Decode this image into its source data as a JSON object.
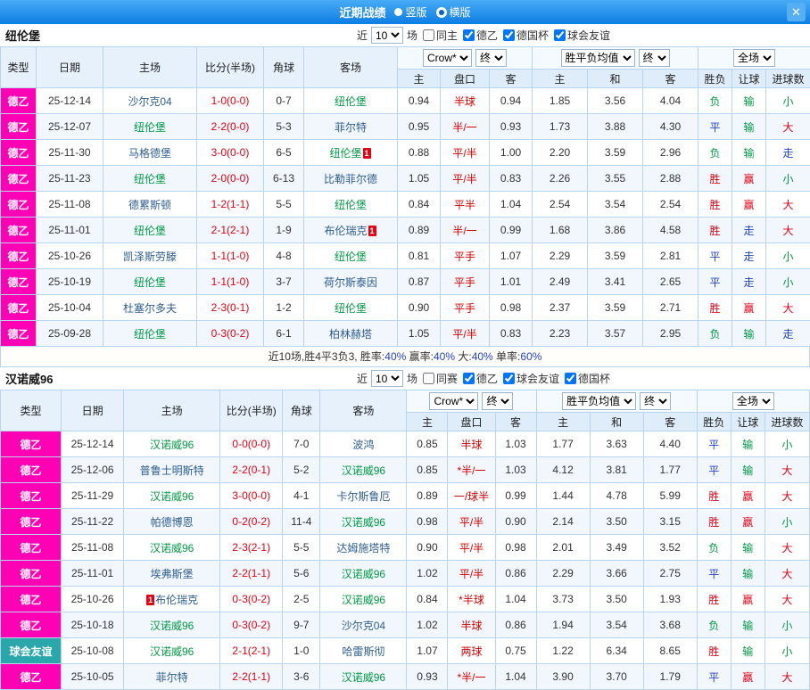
{
  "titlebar": {
    "title": "近期战绩",
    "radio_vertical": "竖版",
    "radio_horizontal": "横版",
    "close_icon": "✕"
  },
  "filter_labels": {
    "near": "近",
    "games": "场"
  },
  "columns": {
    "left": [
      "类型",
      "日期",
      "主场",
      "比分(半场)",
      "角球",
      "客场"
    ],
    "group_selects": [
      [
        "Crow*",
        "终"
      ],
      [
        "胜平负均值",
        "终"
      ],
      [
        "全场"
      ]
    ],
    "sub": [
      "主",
      "盘口",
      "客",
      "主",
      "和",
      "客",
      "胜负",
      "让球",
      "进球数"
    ]
  },
  "colors": {
    "league": {
      "德乙": "#ff00b4",
      "球会友谊": "#2aa7ab"
    },
    "result": {
      "胜": "#e60012",
      "赢": "#e60012",
      "大": "#e60012",
      "平": "#2144cc",
      "走": "#2144cc",
      "负": "#009944",
      "输": "#009944",
      "小": "#009944"
    },
    "score": "#e60012",
    "handicap": "#d40000",
    "self_team": "#009944",
    "opp_team": "#2f5e8f",
    "date": "#333333",
    "odds": "#333333"
  },
  "sections": [
    {
      "team": "纽伦堡",
      "count": "10",
      "filters": [
        {
          "label": "同主",
          "checked": false
        },
        {
          "label": "德乙",
          "checked": true
        },
        {
          "label": "德国杯",
          "checked": true
        },
        {
          "label": "球会友谊",
          "checked": true
        }
      ],
      "rows": [
        {
          "league": "德乙",
          "date": "25-12-14",
          "home": {
            "name": "沙尔克04",
            "self": false
          },
          "score": "1-0(0-0)",
          "corners": "0-7",
          "away": {
            "name": "纽伦堡",
            "self": true
          },
          "odds": [
            "0.94",
            "半球",
            "0.94"
          ],
          "avg": [
            "1.85",
            "3.56",
            "4.04"
          ],
          "results": [
            "负",
            "输",
            "小"
          ]
        },
        {
          "league": "德乙",
          "date": "25-12-07",
          "home": {
            "name": "纽伦堡",
            "self": true
          },
          "score": "2-2(0-0)",
          "corners": "5-3",
          "away": {
            "name": "菲尔特",
            "self": false
          },
          "odds": [
            "0.95",
            "半/一",
            "0.93"
          ],
          "avg": [
            "1.73",
            "3.88",
            "4.30"
          ],
          "results": [
            "平",
            "输",
            "大"
          ]
        },
        {
          "league": "德乙",
          "date": "25-11-30",
          "home": {
            "name": "马格德堡",
            "self": false
          },
          "score": "3-0(0-0)",
          "corners": "6-5",
          "away": {
            "name": "纽伦堡",
            "self": true,
            "badge": "1"
          },
          "odds": [
            "0.88",
            "平/半",
            "1.00"
          ],
          "avg": [
            "2.20",
            "3.59",
            "2.96"
          ],
          "results": [
            "负",
            "输",
            "走"
          ]
        },
        {
          "league": "德乙",
          "date": "25-11-23",
          "home": {
            "name": "纽伦堡",
            "self": true
          },
          "score": "2-0(0-0)",
          "corners": "6-13",
          "away": {
            "name": "比勒菲尔德",
            "self": false
          },
          "odds": [
            "1.05",
            "平/半",
            "0.83"
          ],
          "avg": [
            "2.26",
            "3.55",
            "2.88"
          ],
          "results": [
            "胜",
            "赢",
            "小"
          ]
        },
        {
          "league": "德乙",
          "date": "25-11-08",
          "home": {
            "name": "德累斯顿",
            "self": false
          },
          "score": "1-2(1-1)",
          "corners": "5-5",
          "away": {
            "name": "纽伦堡",
            "self": true
          },
          "odds": [
            "0.84",
            "平半",
            "1.04"
          ],
          "avg": [
            "2.54",
            "3.54",
            "2.54"
          ],
          "results": [
            "胜",
            "赢",
            "大"
          ]
        },
        {
          "league": "德乙",
          "date": "25-11-01",
          "home": {
            "name": "纽伦堡",
            "self": true
          },
          "score": "2-1(2-1)",
          "corners": "1-9",
          "away": {
            "name": "布伦瑞克",
            "self": false,
            "badge": "1"
          },
          "odds": [
            "0.89",
            "半/一",
            "0.99"
          ],
          "avg": [
            "1.68",
            "3.86",
            "4.58"
          ],
          "results": [
            "胜",
            "走",
            "大"
          ]
        },
        {
          "league": "德乙",
          "date": "25-10-26",
          "home": {
            "name": "凯泽斯劳滕",
            "self": false
          },
          "score": "1-1(1-0)",
          "corners": "4-8",
          "away": {
            "name": "纽伦堡",
            "self": true
          },
          "odds": [
            "0.81",
            "平手",
            "1.07"
          ],
          "avg": [
            "2.29",
            "3.59",
            "2.81"
          ],
          "results": [
            "平",
            "走",
            "小"
          ]
        },
        {
          "league": "德乙",
          "date": "25-10-19",
          "home": {
            "name": "纽伦堡",
            "self": true
          },
          "score": "1-1(1-0)",
          "corners": "3-7",
          "away": {
            "name": "荷尔斯泰因",
            "self": false
          },
          "odds": [
            "0.87",
            "平手",
            "1.01"
          ],
          "avg": [
            "2.49",
            "3.41",
            "2.65"
          ],
          "results": [
            "平",
            "走",
            "小"
          ]
        },
        {
          "league": "德乙",
          "date": "25-10-04",
          "home": {
            "name": "杜塞尔多夫",
            "self": false
          },
          "score": "2-3(0-1)",
          "corners": "1-2",
          "away": {
            "name": "纽伦堡",
            "self": true
          },
          "odds": [
            "0.90",
            "平手",
            "0.98"
          ],
          "avg": [
            "2.37",
            "3.59",
            "2.71"
          ],
          "results": [
            "胜",
            "赢",
            "大"
          ]
        },
        {
          "league": "德乙",
          "date": "25-09-28",
          "home": {
            "name": "纽伦堡",
            "self": true
          },
          "score": "0-3(0-2)",
          "corners": "6-1",
          "away": {
            "name": "柏林赫塔",
            "self": false
          },
          "odds": [
            "1.05",
            "平/半",
            "0.83"
          ],
          "avg": [
            "2.23",
            "3.57",
            "2.95"
          ],
          "results": [
            "负",
            "输",
            "走"
          ]
        }
      ],
      "summary": [
        {
          "t": "近10场,胜4平3负3, 胜率:",
          "c": "#333333"
        },
        {
          "t": "40%",
          "c": "#2144cc"
        },
        {
          "t": " 赢率:",
          "c": "#333333"
        },
        {
          "t": "40%",
          "c": "#2144cc"
        },
        {
          "t": " 大:",
          "c": "#333333"
        },
        {
          "t": "40%",
          "c": "#2144cc"
        },
        {
          "t": " 单率:",
          "c": "#333333"
        },
        {
          "t": "60%",
          "c": "#2144cc"
        }
      ]
    },
    {
      "team": "汉诺威96",
      "count": "10",
      "filters": [
        {
          "label": "同赛",
          "checked": false
        },
        {
          "label": "德乙",
          "checked": true
        },
        {
          "label": "球会友谊",
          "checked": true
        },
        {
          "label": "德国杯",
          "checked": true
        }
      ],
      "rows": [
        {
          "league": "德乙",
          "date": "25-12-14",
          "home": {
            "name": "汉诺威96",
            "self": true
          },
          "score": "0-0(0-0)",
          "corners": "7-0",
          "away": {
            "name": "波鸿",
            "self": false
          },
          "odds": [
            "0.85",
            "半球",
            "1.03"
          ],
          "avg": [
            "1.77",
            "3.63",
            "4.40"
          ],
          "results": [
            "平",
            "输",
            "小"
          ]
        },
        {
          "league": "德乙",
          "date": "25-12-06",
          "home": {
            "name": "普鲁士明斯特",
            "self": false
          },
          "score": "2-2(0-1)",
          "corners": "5-2",
          "away": {
            "name": "汉诺威96",
            "self": true
          },
          "odds": [
            "0.85",
            "*半/一",
            "1.03"
          ],
          "avg": [
            "4.12",
            "3.81",
            "1.77"
          ],
          "results": [
            "平",
            "输",
            "大"
          ]
        },
        {
          "league": "德乙",
          "date": "25-11-29",
          "home": {
            "name": "汉诺威96",
            "self": true
          },
          "score": "3-0(0-0)",
          "corners": "4-1",
          "away": {
            "name": "卡尔斯鲁厄",
            "self": false
          },
          "odds": [
            "0.89",
            "一/球半",
            "0.99"
          ],
          "avg": [
            "1.44",
            "4.78",
            "5.99"
          ],
          "results": [
            "胜",
            "赢",
            "大"
          ]
        },
        {
          "league": "德乙",
          "date": "25-11-22",
          "home": {
            "name": "帕德博恩",
            "self": false
          },
          "score": "0-2(0-2)",
          "corners": "11-4",
          "away": {
            "name": "汉诺威96",
            "self": true
          },
          "odds": [
            "0.98",
            "平/半",
            "0.90"
          ],
          "avg": [
            "2.14",
            "3.50",
            "3.15"
          ],
          "results": [
            "胜",
            "赢",
            "小"
          ]
        },
        {
          "league": "德乙",
          "date": "25-11-08",
          "home": {
            "name": "汉诺威96",
            "self": true
          },
          "score": "2-3(2-1)",
          "corners": "5-5",
          "away": {
            "name": "达姆施塔特",
            "self": false
          },
          "odds": [
            "0.90",
            "平/半",
            "0.98"
          ],
          "avg": [
            "2.01",
            "3.49",
            "3.52"
          ],
          "results": [
            "负",
            "输",
            "大"
          ]
        },
        {
          "league": "德乙",
          "date": "25-11-01",
          "home": {
            "name": "埃弗斯堡",
            "self": false
          },
          "score": "2-2(1-1)",
          "corners": "5-6",
          "away": {
            "name": "汉诺威96",
            "self": true
          },
          "odds": [
            "1.02",
            "平/半",
            "0.86"
          ],
          "avg": [
            "2.29",
            "3.66",
            "2.75"
          ],
          "results": [
            "平",
            "输",
            "大"
          ]
        },
        {
          "league": "德乙",
          "date": "25-10-26",
          "home": {
            "name": "布伦瑞克",
            "self": false,
            "badge": "1",
            "badge_pos": "before"
          },
          "score": "0-3(0-2)",
          "corners": "2-5",
          "away": {
            "name": "汉诺威96",
            "self": true
          },
          "odds": [
            "0.84",
            "*半球",
            "1.04"
          ],
          "avg": [
            "3.73",
            "3.50",
            "1.93"
          ],
          "results": [
            "胜",
            "赢",
            "大"
          ]
        },
        {
          "league": "德乙",
          "date": "25-10-18",
          "home": {
            "name": "汉诺威96",
            "self": true
          },
          "score": "0-3(0-2)",
          "corners": "9-7",
          "away": {
            "name": "沙尔克04",
            "self": false
          },
          "odds": [
            "1.02",
            "半球",
            "0.86"
          ],
          "avg": [
            "1.94",
            "3.54",
            "3.68"
          ],
          "results": [
            "负",
            "输",
            "小"
          ]
        },
        {
          "league": "球会友谊",
          "date": "25-10-08",
          "home": {
            "name": "汉诺威96",
            "self": true
          },
          "score": "2-1(2-1)",
          "corners": "1-0",
          "away": {
            "name": "哈雷斯彻",
            "self": false
          },
          "odds": [
            "1.07",
            "两球",
            "0.75"
          ],
          "avg": [
            "1.22",
            "6.34",
            "8.65"
          ],
          "results": [
            "胜",
            "输",
            "小"
          ]
        },
        {
          "league": "德乙",
          "date": "25-10-05",
          "home": {
            "name": "菲尔特",
            "self": false
          },
          "score": "2-2(1-1)",
          "corners": "3-6",
          "away": {
            "name": "汉诺威96",
            "self": true
          },
          "odds": [
            "0.93",
            "*半/一",
            "1.04"
          ],
          "avg": [
            "3.90",
            "3.70",
            "1.79"
          ],
          "results": [
            "平",
            "赢",
            "大"
          ]
        }
      ]
    }
  ]
}
